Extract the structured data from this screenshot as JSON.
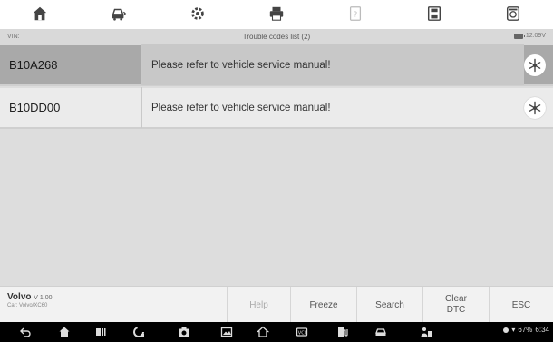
{
  "toolbar": {
    "icons": [
      "home-icon",
      "vehicle-icon",
      "settings-icon",
      "print-icon",
      "help-icon",
      "save-icon",
      "screenshot-icon"
    ]
  },
  "info_bar": {
    "vin_label": "VIN:",
    "title": "Trouble codes list (2)",
    "voltage": "12.09V"
  },
  "dtc_list": [
    {
      "code": "B10A268",
      "description": "Please refer to vehicle service manual!"
    },
    {
      "code": "B10DD00",
      "description": "Please refer to vehicle service manual!"
    }
  ],
  "vehicle_info": {
    "make": "Volvo",
    "version": "V 1.00",
    "car": "Car: Volvo/XC60"
  },
  "function_buttons": {
    "help": "Help",
    "freeze": "Freeze",
    "search": "Search",
    "clear_dtc": "Clear DTC",
    "esc": "ESC"
  },
  "status_bar": {
    "battery_percent": "67%",
    "time": "6:34"
  }
}
